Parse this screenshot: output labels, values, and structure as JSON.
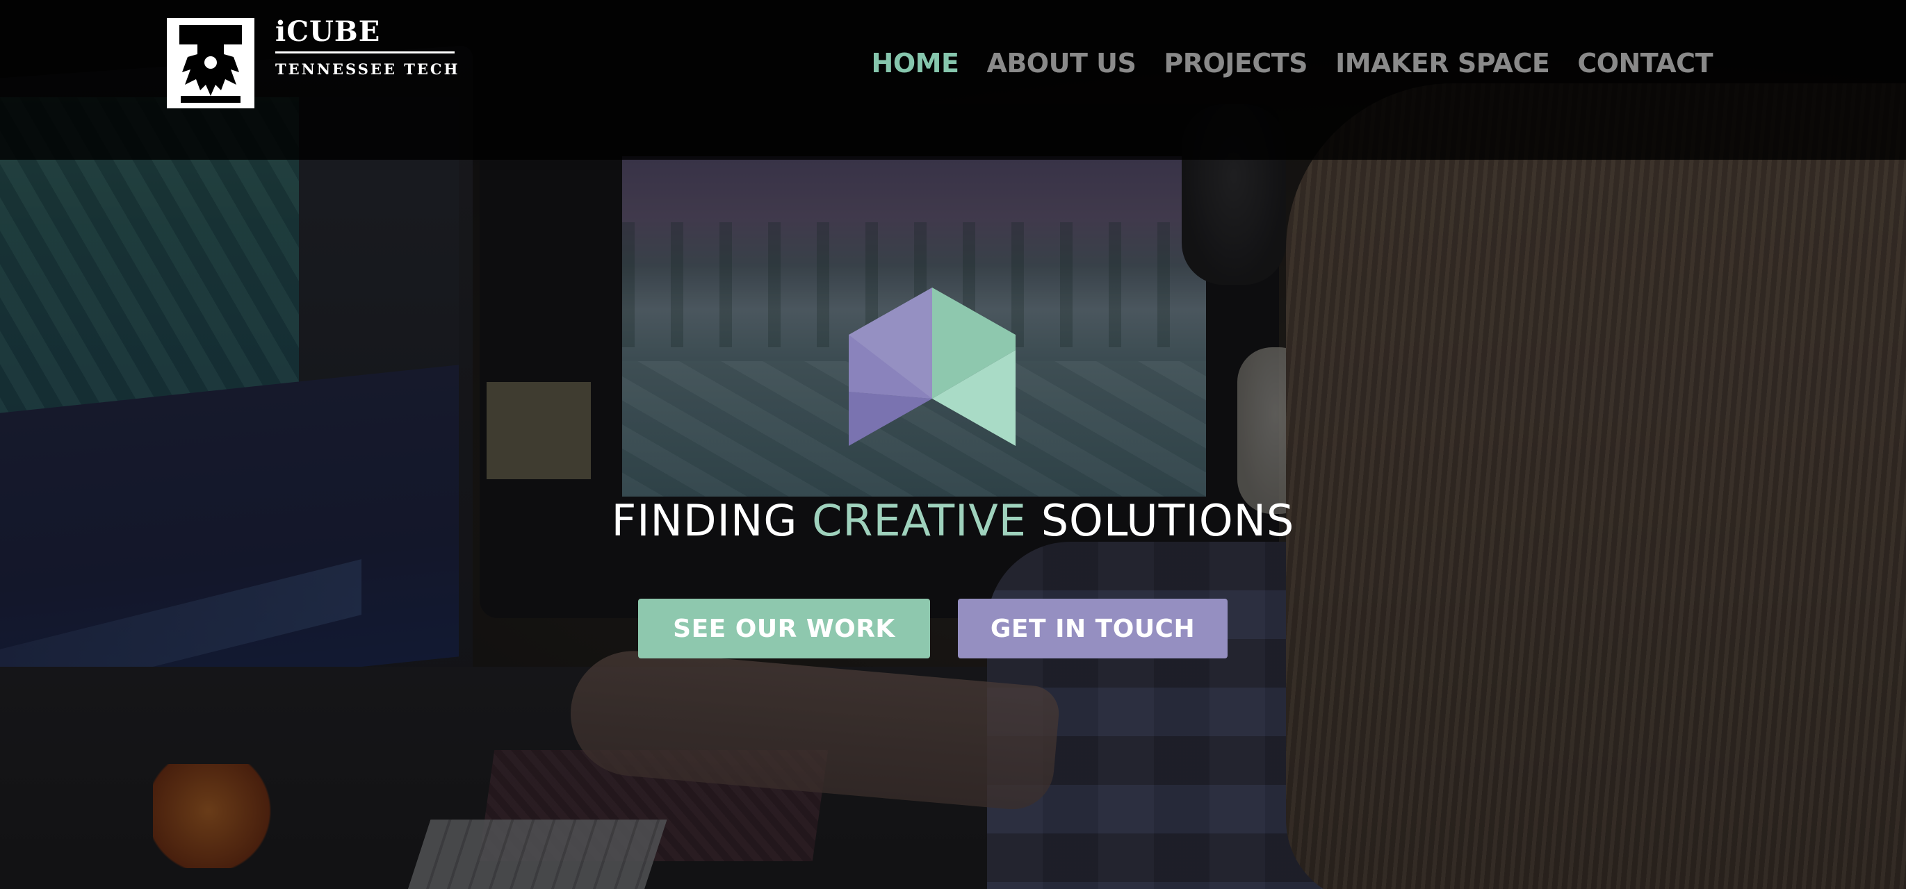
{
  "header": {
    "logo": {
      "title": "iCUBE",
      "subtitle": "TENNESSEE TECH",
      "emblem_icon": "tennessee-tech-eagle-emblem"
    },
    "nav": [
      {
        "label": "HOME",
        "active": true
      },
      {
        "label": "ABOUT US",
        "active": false
      },
      {
        "label": "PROJECTS",
        "active": false
      },
      {
        "label": "IMAKER SPACE",
        "active": false
      },
      {
        "label": "CONTACT",
        "active": false
      }
    ]
  },
  "hero": {
    "logo_icon": "icube-cube-icon",
    "headline": {
      "part1": "FINDING ",
      "accent": "CREATIVE",
      "part2": " SOLUTIONS"
    },
    "buttons": {
      "primary_label": "SEE OUR WORK",
      "secondary_label": "GET IN TOUCH"
    },
    "background_image": "person working at computer monitors with 3D game scene on screen"
  },
  "colors": {
    "accent_green": "#8ec8ae",
    "accent_purple": "#958fc1",
    "nav_active": "#86c6ad",
    "nav_inactive": "#8a8a8a",
    "header_bg": "#000000"
  }
}
